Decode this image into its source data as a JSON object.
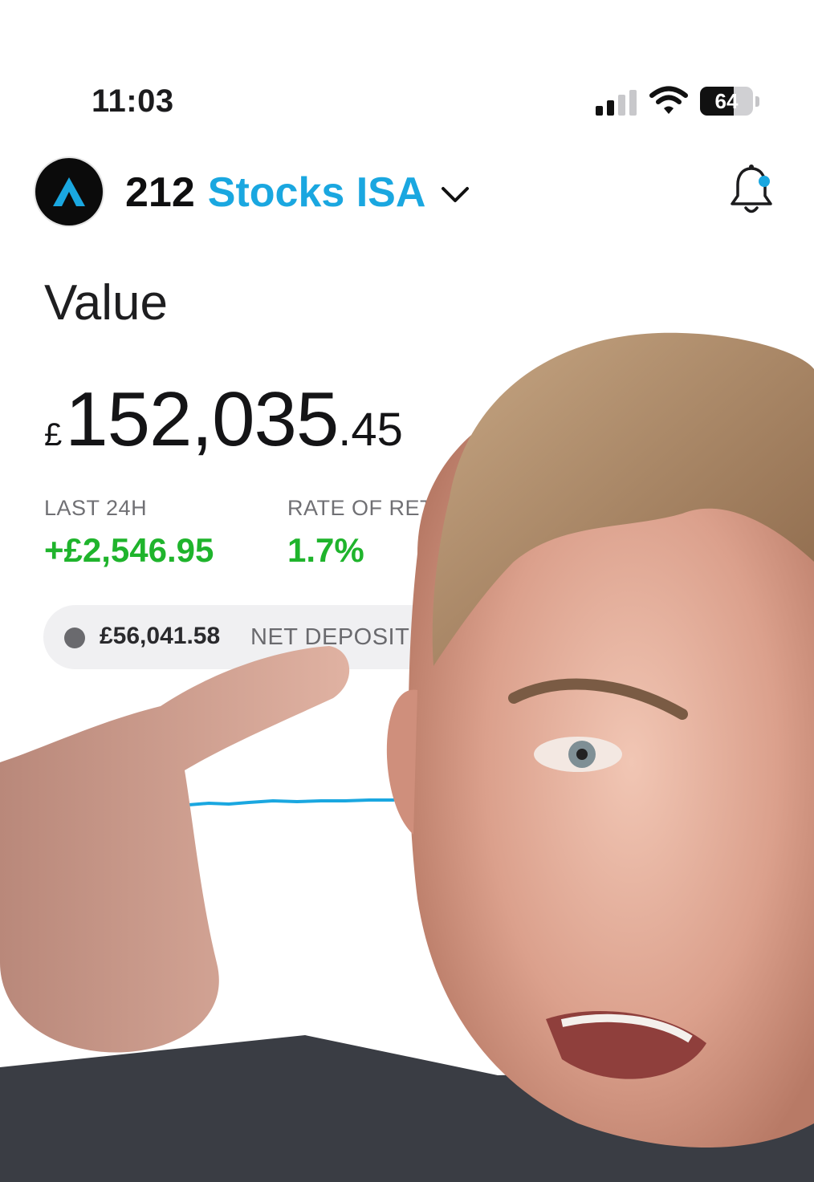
{
  "status_bar": {
    "time": "11:03",
    "battery_percent": "64",
    "battery_level": 0.64,
    "signal_bars": 2,
    "icons": [
      "signal-icon",
      "wifi-icon",
      "battery-icon"
    ]
  },
  "header": {
    "account_number": "212",
    "account_name": "Stocks ISA",
    "icons": [
      "logo-icon",
      "chevron-down-icon",
      "bell-icon"
    ],
    "notification_dot": true
  },
  "portfolio": {
    "label": "Value",
    "currency_symbol": "£",
    "value_main": "152,035",
    "value_decimal": ".45",
    "last_24h_label": "LAST 24H",
    "last_24h_value": "+£2,546.95",
    "rate_of_return_label": "RATE OF RET",
    "rate_of_return_value": "1.7%",
    "net_deposits_amount": "£56,041.58",
    "net_deposits_label": "NET DEPOSITS"
  },
  "colors": {
    "accent": "#1aa7e0",
    "positive": "#1fb42c",
    "text": "#1c1c1e",
    "muted": "#707074"
  }
}
